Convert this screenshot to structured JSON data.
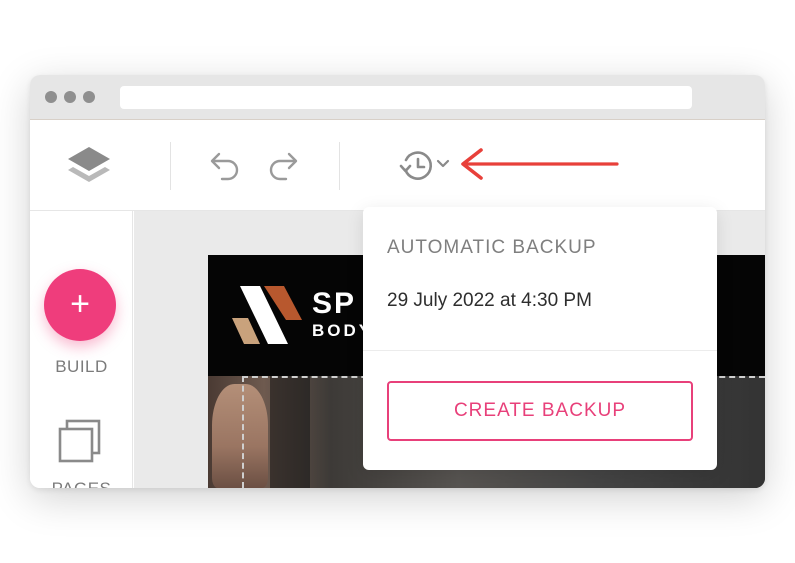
{
  "backup_menu": {
    "heading": "AUTOMATIC BACKUP",
    "last_backup": "29 July 2022 at 4:30 PM",
    "create_label": "CREATE BACKUP"
  },
  "sidebar": {
    "build_symbol": "+",
    "build_label": "BUILD",
    "pages_label": "PAGES"
  },
  "preview": {
    "brand_main": "SP",
    "brand_sub": "BODY"
  },
  "icons": {
    "layers": "layers-icon",
    "undo": "undo-icon",
    "redo": "redo-icon",
    "backup_history": "backup-history-icon",
    "dropdown": "chevron-down-icon",
    "pages": "pages-icon",
    "annotation": "arrow-left-icon"
  },
  "colors": {
    "accent": "#ef3d7c",
    "annotation_arrow": "#e8403a",
    "icon_gray": "#8a8a8a"
  }
}
